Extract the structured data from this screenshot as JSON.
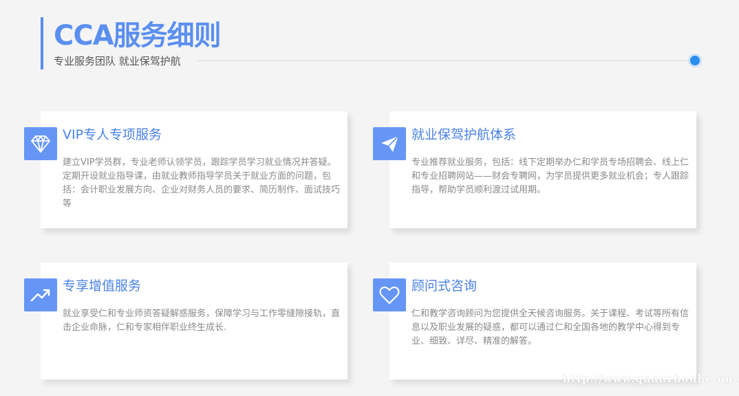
{
  "header": {
    "title": "CCA服务细则",
    "subtitle": "专业服务团队 就业保驾护航"
  },
  "cards": [
    {
      "icon": "diamond-icon",
      "title": "VIP专人专项服务",
      "text": "建立VIP学员群，专业老师认领学员，跟踪学员学习就业情况并答疑。定期开设就业指导课，由就业教师指导学员关于就业方面的问题，包括：会计职业发展方向、企业对财务人员的要求、简历制作、面试技巧等"
    },
    {
      "icon": "paper-plane-icon",
      "title": "就业保驾护航体系",
      "text": "专业推荐就业服务，包括：线下定期举办仁和学员专场招聘会、线上仁和专业招聘网站——财会专聘网，为学员提供更多就业机会；专人跟踪指导，帮助学员顺利渡过试用期。"
    },
    {
      "icon": "trending-up-icon",
      "title": "专享增值服务",
      "text": "就业享受仁和专业师资答疑解惑服务，保障学习与工作零缝隙接轨，直击企业命脉，仁和专家相伴职业终生成长."
    },
    {
      "icon": "heart-icon",
      "title": "顾问式咨询",
      "text": "仁和教学咨询顾问为您提供全天候咨询服务。关于课程、考试等所有信息以及职业发展的疑惑，都可以通过仁和全国各地的教学中心得到专业、细致、详尽、精准的解答。"
    }
  ],
  "watermark": "http://www.quanzhouhe ng.com",
  "colors": {
    "accent": "#5b8ff0",
    "icon_bg": "#6596f5",
    "dot": "#2a8ff0",
    "card_title": "#4a82e6",
    "body_text": "#8a8a8a",
    "background": "#f4f4f4"
  }
}
